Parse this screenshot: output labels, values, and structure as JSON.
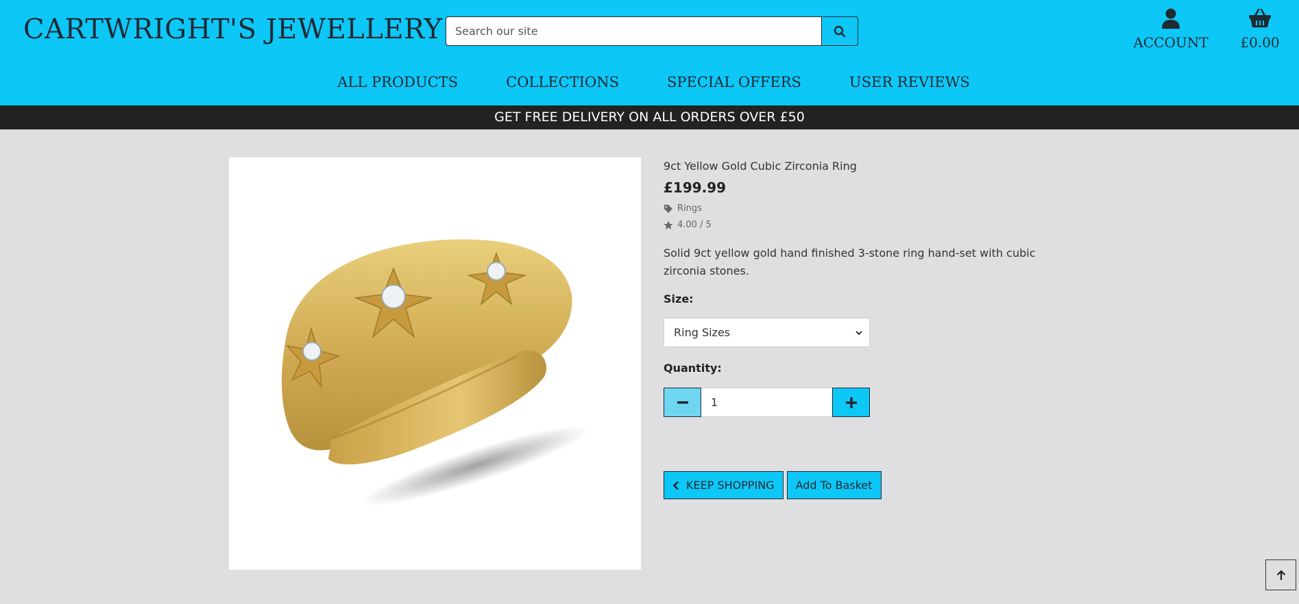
{
  "header": {
    "logo": "CARTWRIGHT'S JEWELLERY",
    "search_placeholder": "Search our site",
    "account_label": "ACCOUNT",
    "basket_total": "£0.00"
  },
  "nav": {
    "items": [
      "ALL PRODUCTS",
      "COLLECTIONS",
      "SPECIAL OFFERS",
      "USER REVIEWS"
    ]
  },
  "promo": "GET FREE DELIVERY ON ALL ORDERS OVER £50",
  "product": {
    "name": "9ct Yellow Gold Cubic Zirconia Ring",
    "price": "£199.99",
    "category": "Rings",
    "rating": "4.00 / 5",
    "description": "Solid 9ct yellow gold hand finished 3-stone ring hand-set with cubic zirconia stones.",
    "size_label": "Size:",
    "size_selected": "Ring Sizes",
    "quantity_label": "Quantity:",
    "quantity_value": "1",
    "keep_shopping": "KEEP SHOPPING",
    "add_to_basket": "Add To Basket"
  },
  "colors": {
    "brand": "#0dc7f7",
    "dark": "#222222",
    "background": "#dfdfe1"
  },
  "icons": {
    "search": "search-icon",
    "account": "user-icon",
    "basket": "basket-icon",
    "category": "tag-icon",
    "rating": "star-icon",
    "minus": "minus-icon",
    "plus": "plus-icon",
    "back": "chevron-left-icon",
    "to_top": "arrow-up-icon"
  }
}
